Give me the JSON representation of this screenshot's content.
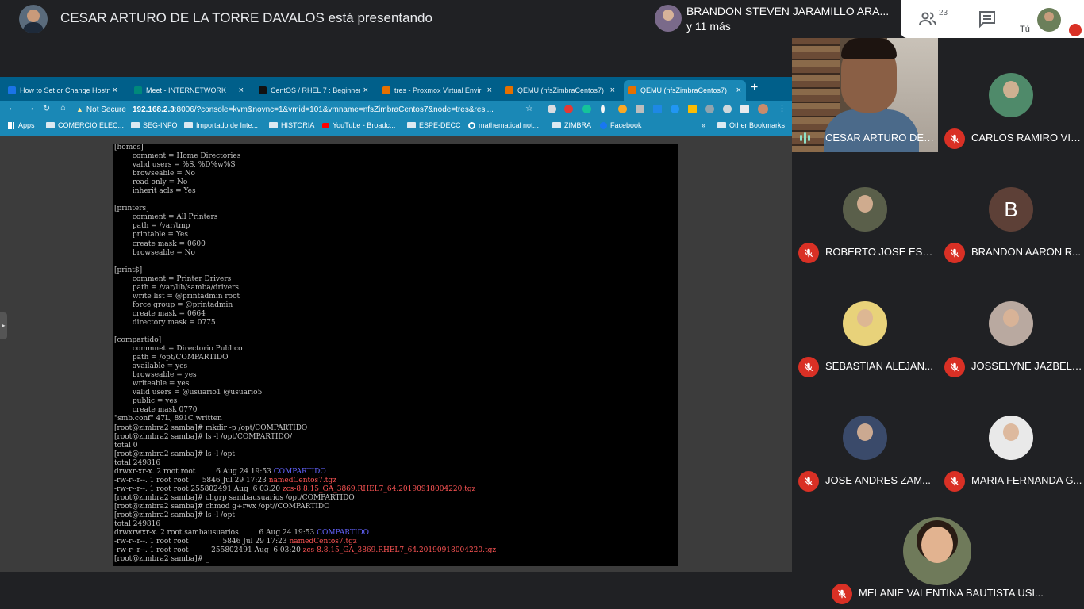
{
  "meet": {
    "presenter_text": "CESAR ARTURO DE LA TORRE DAVALOS está presentando",
    "active_speaker": "BRANDON STEVEN JARAMILLO ARA...",
    "others_count": "y 11 más",
    "people_count": "23",
    "self_label": "Tú",
    "accent": "#d93025"
  },
  "browser": {
    "tabs": [
      {
        "title": "How to Set or Change Hostn",
        "color": "#1a73e8"
      },
      {
        "title": "Meet - INTERNETWORK",
        "color": "#00897b"
      },
      {
        "title": "CentOS / RHEL 7 : Beginner",
        "color": "#111111"
      },
      {
        "title": "tres - Proxmox Virtual Envir",
        "color": "#e57000"
      },
      {
        "title": "QEMU (nfsZimbraCentos7)",
        "color": "#e57000"
      },
      {
        "title": "QEMU (nfsZimbraCentos7)",
        "color": "#e57000"
      }
    ],
    "new_tab": "+",
    "not_secure": "Not Secure",
    "url_host": "192.168.2.3",
    "url_rest": ":8006/?console=kvm&novnc=1&vmid=101&vmname=nfsZimbraCentos7&node=tres&resi...",
    "bookmarks": [
      {
        "label": "Apps",
        "icon": "apps"
      },
      {
        "label": "COMERCIO ELEC...",
        "icon": "folder"
      },
      {
        "label": "SEG-INFO",
        "icon": "folder"
      },
      {
        "label": "Importado de Inte...",
        "icon": "folder"
      },
      {
        "label": "HISTORIA",
        "icon": "folder"
      },
      {
        "label": "YouTube - Broadc...",
        "icon": "youtube"
      },
      {
        "label": "ESPE-DECC",
        "icon": "folder"
      },
      {
        "label": "mathematical not...",
        "icon": "google"
      },
      {
        "label": "ZIMBRA",
        "icon": "folder"
      },
      {
        "label": "Facebook",
        "icon": "facebook"
      }
    ],
    "bookmarks_more": "»",
    "other_bookmarks": "Other Bookmarks"
  },
  "terminal": {
    "lines": [
      [
        {
          "t": "[homes]"
        }
      ],
      [
        {
          "t": "        comment = Home Directories"
        }
      ],
      [
        {
          "t": "        valid users = %S, %D%w%S"
        }
      ],
      [
        {
          "t": "        browseable = No"
        }
      ],
      [
        {
          "t": "        read only = No"
        }
      ],
      [
        {
          "t": "        inherit acls = Yes"
        }
      ],
      [
        {
          "t": ""
        }
      ],
      [
        {
          "t": "[printers]"
        }
      ],
      [
        {
          "t": "        comment = All Printers"
        }
      ],
      [
        {
          "t": "        path = /var/tmp"
        }
      ],
      [
        {
          "t": "        printable = Yes"
        }
      ],
      [
        {
          "t": "        create mask = 0600"
        }
      ],
      [
        {
          "t": "        browseable = No"
        }
      ],
      [
        {
          "t": ""
        }
      ],
      [
        {
          "t": "[print$]"
        }
      ],
      [
        {
          "t": "        comment = Printer Drivers"
        }
      ],
      [
        {
          "t": "        path = /var/lib/samba/drivers"
        }
      ],
      [
        {
          "t": "        write list = @printadmin root"
        }
      ],
      [
        {
          "t": "        force group = @printadmin"
        }
      ],
      [
        {
          "t": "        create mask = 0664"
        }
      ],
      [
        {
          "t": "        directory mask = 0775"
        }
      ],
      [
        {
          "t": ""
        }
      ],
      [
        {
          "t": "[compartido]"
        }
      ],
      [
        {
          "t": "        commnet = Directorio Publico"
        }
      ],
      [
        {
          "t": "        path = /opt/COMPARTIDO"
        }
      ],
      [
        {
          "t": "        available = yes"
        }
      ],
      [
        {
          "t": "        browseable = yes"
        }
      ],
      [
        {
          "t": "        writeable = yes"
        }
      ],
      [
        {
          "t": "        valid users = @usuario1 @usuario5"
        }
      ],
      [
        {
          "t": "        public = yes"
        }
      ],
      [
        {
          "t": "        create mask 0770"
        }
      ],
      [
        {
          "t": "\"smb.conf\" 47L, 891C written"
        }
      ],
      [
        {
          "t": "[root@zimbra2 samba]# mkdir -p /opt/COMPARTIDO"
        }
      ],
      [
        {
          "t": "[root@zimbra2 samba]# ls -l /opt/COMPARTIDO/"
        }
      ],
      [
        {
          "t": "total 0"
        }
      ],
      [
        {
          "t": "[root@zimbra2 samba]# ls -l /opt"
        }
      ],
      [
        {
          "t": "total 249816"
        }
      ],
      [
        {
          "t": "drwxr-xr-x. 2 root root         6 Aug 24 19:53 "
        },
        {
          "t": "COMPARTIDO",
          "c": "blue"
        }
      ],
      [
        {
          "t": "-rw-r--r--. 1 root root      5846 Jul 29 17:23 "
        },
        {
          "t": "namedCentos7.tgz",
          "c": "red"
        }
      ],
      [
        {
          "t": "-rw-r--r--. 1 root root 255802491 Aug  6 03:20 "
        },
        {
          "t": "zcs-8.8.15_GA_3869.RHEL7_64.20190918004220.tgz",
          "c": "red"
        }
      ],
      [
        {
          "t": "[root@zimbra2 samba]# chgrp sambausuarios /opt/COMPARTIDO"
        }
      ],
      [
        {
          "t": "[root@zimbra2 samba]# chmod g+rwx /opt//COMPARTIDO"
        }
      ],
      [
        {
          "t": "[root@zimbra2 samba]# ls -l /opt"
        }
      ],
      [
        {
          "t": "total 249816"
        }
      ],
      [
        {
          "t": "drwxrwxr-x. 2 root sambausuarios         6 Aug 24 19:53 "
        },
        {
          "t": "COMPARTIDO",
          "c": "blue"
        }
      ],
      [
        {
          "t": "-rw-r--r--. 1 root root               5846 Jul 29 17:23 "
        },
        {
          "t": "namedCentos7.tgz",
          "c": "red"
        }
      ],
      [
        {
          "t": "-rw-r--r--. 1 root root          255802491 Aug  6 03:20 "
        },
        {
          "t": "zcs-8.8.15_GA_3869.RHEL7_64.20190918004220.tgz",
          "c": "red"
        }
      ],
      [
        {
          "t": "[root@zimbra2 samba]# _"
        }
      ]
    ]
  },
  "participants": {
    "video": {
      "name": "CESAR ARTURO DE L..."
    },
    "tiles": [
      {
        "name": "CARLOS RAMIRO VIL...",
        "avatar_color": "#4f8a6a"
      },
      {
        "name": "ROBERTO JOSE ESPI...",
        "avatar_color": "#5a5f4a"
      },
      {
        "name": "BRANDON AARON R...",
        "avatar_color": "#5d4037",
        "letter": "B"
      },
      {
        "name": "SEBASTIAN ALEJAN...",
        "avatar_color": "#e8d27a"
      },
      {
        "name": "JOSSELYNE JAZBEL ...",
        "avatar_color": "#b9a9a0"
      },
      {
        "name": "JOSE ANDRES ZAM...",
        "avatar_color": "#3a4a6a"
      },
      {
        "name": "MARIA FERNANDA G...",
        "avatar_color": "#e9e9e9"
      }
    ],
    "big": {
      "name": "MELANIE VALENTINA BAUTISTA USI..."
    }
  }
}
